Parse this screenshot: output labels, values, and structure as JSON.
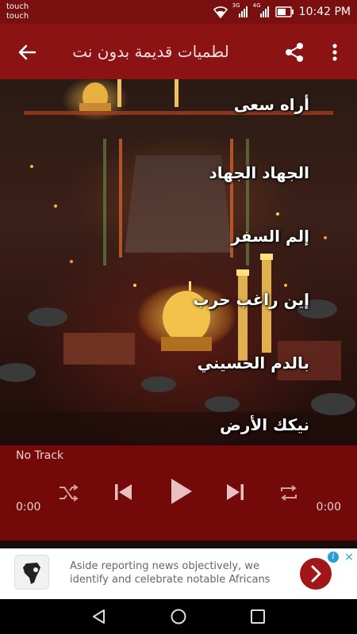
{
  "status_bar": {
    "left_lines": [
      "touch",
      "touch"
    ],
    "network_3g": "3G",
    "network_4g": "4G",
    "time": "10:42 PM"
  },
  "app_bar": {
    "title": "لطميات قديمة بدون نت"
  },
  "lyrics": [
    "أراه سعى",
    "الجهاد الجهاد",
    "إلم السفر",
    "إين راغب حرب",
    "بالدم الحسيني",
    "نيكك الأرض"
  ],
  "player": {
    "track_name": "No Track",
    "elapsed": "0:00",
    "duration": "0:00"
  },
  "ad": {
    "text": "Aside reporting news objectively, we identify and celebrate notable Africans",
    "info_icon": "i",
    "close_icon": "×"
  },
  "colors": {
    "app_bar": "#8b1313",
    "status_bar": "#7a0f0f",
    "player_overlay": "#960a0a",
    "ad_cta": "#a11616"
  }
}
